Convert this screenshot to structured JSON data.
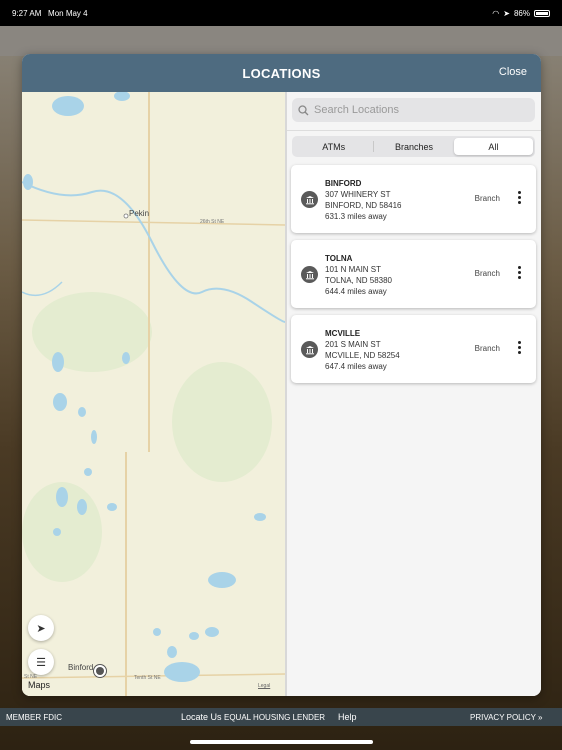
{
  "status_bar": {
    "time": "9:27 AM",
    "date": "Mon May 4",
    "battery": "86%",
    "battery_level": 0.86
  },
  "modal": {
    "title": "LOCATIONS",
    "close_label": "Close"
  },
  "map": {
    "town_label": "Pekin",
    "road_label": "26th St NE",
    "town_label_2": "Binford",
    "road_label_2": "Tenth St NE",
    "road_label_3": "St NE",
    "attribution": "Maps",
    "legal": "Legal"
  },
  "search": {
    "placeholder": "Search Locations"
  },
  "filter": {
    "options": [
      "ATMs",
      "Branches",
      "All"
    ],
    "selected": "All"
  },
  "locations": [
    {
      "name": "BINFORD",
      "street": "307 WHINERY ST",
      "city": "BINFORD, ND 58416",
      "distance": "631.3 miles away",
      "type": "Branch"
    },
    {
      "name": "TOLNA",
      "street": "101 N MAIN ST",
      "city": "TOLNA, ND 58380",
      "distance": "644.4 miles away",
      "type": "Branch"
    },
    {
      "name": "MCVILLE",
      "street": "201 S MAIN ST",
      "city": "MCVILLE, ND 58254",
      "distance": "647.4 miles away",
      "type": "Branch"
    }
  ],
  "footer": {
    "member": "MEMBER FDIC",
    "locate": "Locate Us",
    "equal_housing": "EQUAL HOUSING LENDER",
    "help": "Help",
    "privacy": "PRIVACY POLICY »"
  },
  "colors": {
    "header": "#4e6b80",
    "map_land": "#f2f0dc",
    "map_water": "#a9d3e8"
  }
}
